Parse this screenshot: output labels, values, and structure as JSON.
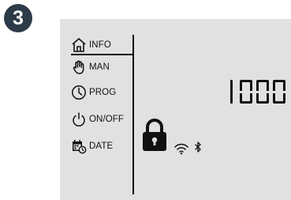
{
  "step": {
    "number": "3"
  },
  "menu": {
    "items": [
      {
        "icon": "home-icon",
        "label": "INFO"
      },
      {
        "icon": "hand-icon",
        "label": "MAN"
      },
      {
        "icon": "clock-icon",
        "label": "PROG"
      },
      {
        "icon": "power-icon",
        "label": "ON/OFF"
      },
      {
        "icon": "calendar-icon",
        "label": "DATE"
      }
    ]
  },
  "display": {
    "value": "1000"
  },
  "status_icons": [
    "lock-icon",
    "wifi-icon",
    "bluetooth-icon"
  ],
  "colors": {
    "badge": "#2d3a48",
    "screen": "#e1e1e1",
    "ink": "#111111"
  }
}
